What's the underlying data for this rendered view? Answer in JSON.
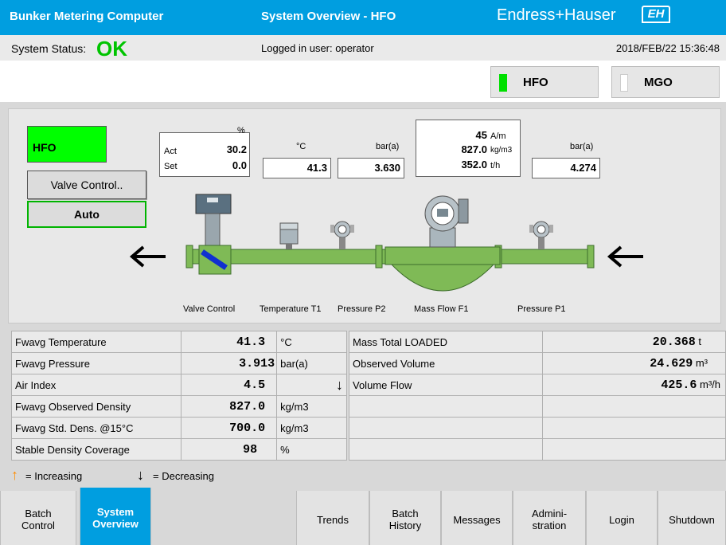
{
  "header": {
    "app_title": "Bunker Metering Computer",
    "view_title": "System Overview - HFO",
    "brand": "Endress+Hauser",
    "logo_text": "EH"
  },
  "status": {
    "label": "System Status:",
    "value": "OK",
    "user": "Logged in user: operator",
    "datetime": "2018/FEB/22  15:36:48"
  },
  "mode": {
    "hfo_label": "HFO",
    "mgo_label": "MGO",
    "hfo_indicator_color": "#00e000",
    "mgo_indicator_color": "#ffffff"
  },
  "overview": {
    "product": "HFO",
    "valve_control_label": "Valve Control..",
    "auto_label": "Auto",
    "valve": {
      "unit": "%",
      "act_label": "Act",
      "act_value": "30.2",
      "set_label": "Set",
      "set_value": "0.0"
    },
    "temperature": {
      "unit": "°C",
      "value": "41.3"
    },
    "pressure_p2": {
      "unit": "bar(a)",
      "value": "3.630"
    },
    "mass_flow": {
      "air_value": "45",
      "air_unit": "A/m",
      "density_value": "827.0",
      "density_unit": "kg/m3",
      "flow_value": "352.0",
      "flow_unit": "t/h"
    },
    "pressure_p1": {
      "unit": "bar(a)",
      "value": "4.274"
    },
    "labels": {
      "valve": "Valve Control",
      "temp": "Temperature T1",
      "p2": "Pressure P2",
      "mass": "Mass Flow F1",
      "p1": "Pressure P1"
    }
  },
  "measurements": [
    {
      "name": "Fwavg Temperature",
      "value": "41.3",
      "unit": "°C",
      "trend": ""
    },
    {
      "name": "Fwavg Pressure",
      "value": "3.913",
      "unit": "bar(a)",
      "trend": ""
    },
    {
      "name": "Air Index",
      "value": "4.5",
      "unit": "",
      "trend": "↓"
    },
    {
      "name": "Fwavg Observed Density",
      "value": "827.0",
      "unit": "kg/m3",
      "trend": ""
    },
    {
      "name": "Fwavg Std. Dens. @15°C",
      "value": "700.0",
      "unit": "kg/m3",
      "trend": ""
    },
    {
      "name": "Stable Density Coverage",
      "value": "98",
      "unit": "%",
      "trend": ""
    }
  ],
  "totals": [
    {
      "name": "Mass Total LOADED",
      "value": "20.368",
      "unit": "t"
    },
    {
      "name": "Observed Volume",
      "value": "24.629",
      "unit": "m³"
    },
    {
      "name": "Volume Flow",
      "value": "425.6",
      "unit": "m³/h"
    },
    {
      "name": "",
      "value": "",
      "unit": ""
    },
    {
      "name": "",
      "value": "",
      "unit": ""
    },
    {
      "name": "",
      "value": "",
      "unit": ""
    }
  ],
  "legend": {
    "increasing": "= Increasing",
    "decreasing": "= Decreasing",
    "up_color": "#ff8c00"
  },
  "tabs": {
    "batch_control": [
      "Batch",
      "Control"
    ],
    "system_overview": [
      "System",
      "Overview"
    ],
    "trends": "Trends",
    "batch_history": [
      "Batch",
      "History"
    ],
    "messages": "Messages",
    "administration": [
      "Admini-",
      "stration"
    ],
    "login": "Login",
    "shutdown": "Shutdown"
  }
}
